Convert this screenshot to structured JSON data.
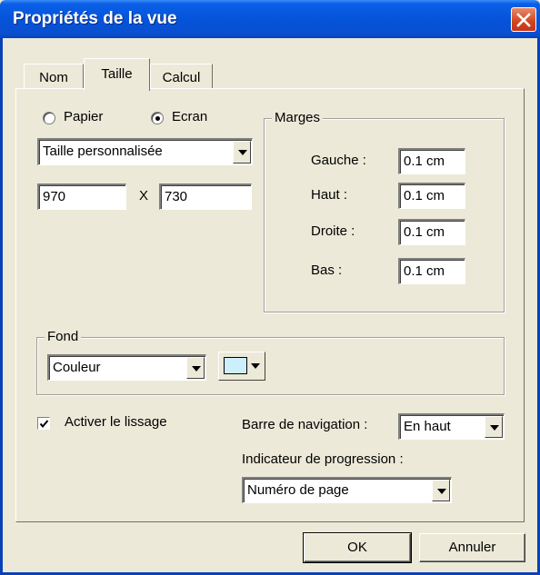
{
  "window": {
    "title": "Propriétés de la vue"
  },
  "tabs": [
    {
      "label": "Nom",
      "active": false
    },
    {
      "label": "Taille",
      "active": true
    },
    {
      "label": "Calcul",
      "active": false
    }
  ],
  "size": {
    "radio_paper": "Papier",
    "radio_screen": "Ecran",
    "selected": "Ecran",
    "preset_value": "Taille personnalisée",
    "width": "970",
    "times": "X",
    "height": "730"
  },
  "margins": {
    "title": "Marges",
    "left_label": "Gauche :",
    "left_value": "0.1 cm",
    "top_label": "Haut :",
    "top_value": "0.1 cm",
    "right_label": "Droite :",
    "right_value": "0.1 cm",
    "bottom_label": "Bas :",
    "bottom_value": "0.1 cm"
  },
  "background": {
    "title": "Fond",
    "type_value": "Couleur",
    "color": "#cdeffb"
  },
  "smoothing": {
    "label": "Activer le lissage",
    "checked": true
  },
  "navigation": {
    "label": "Barre de navigation :",
    "value": "En haut"
  },
  "progress": {
    "label": "Indicateur de progression :",
    "value": "Numéro de page"
  },
  "buttons": {
    "ok": "OK",
    "cancel": "Annuler"
  }
}
